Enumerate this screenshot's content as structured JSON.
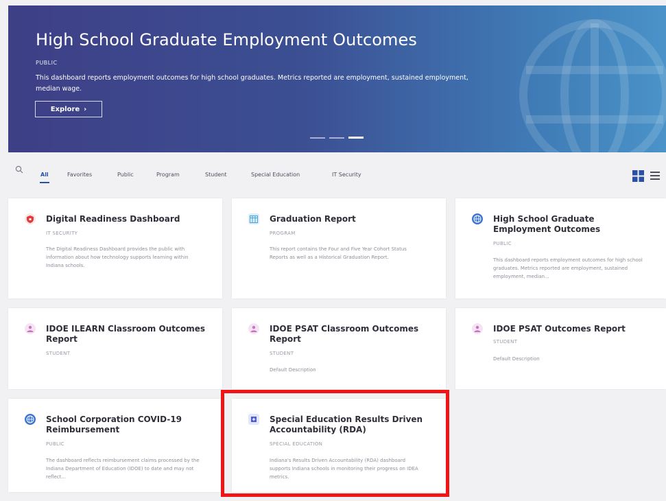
{
  "hero": {
    "title": "High School Graduate Employment Outcomes",
    "badge": "PUBLIC",
    "description": "This dashboard reports employment outcomes for high school graduates. Metrics reported are employment, sustained employment, median wage.",
    "explore_label": "Explore",
    "explore_chevron": "›"
  },
  "filters": {
    "tabs": [
      {
        "label": "All",
        "active": true
      },
      {
        "label": "Favorites"
      },
      {
        "label": "Public"
      },
      {
        "label": "Program"
      },
      {
        "label": "Student"
      },
      {
        "label": "Special Education"
      },
      {
        "label": "IT Security"
      }
    ]
  },
  "icons": {
    "search": "search-icon",
    "grid_view": "grid-view-icon",
    "list_view": "list-view-icon",
    "shield": "shield-icon",
    "table": "table-icon",
    "globe": "globe-icon",
    "user": "user-icon"
  },
  "colors": {
    "accent": "#2b4ea6",
    "highlight": "#f01414",
    "shield": "#e33b3b",
    "table": "#4aa3d8",
    "globe": "#3a74d0",
    "user": "#c774c0",
    "plus": "#4b5bd0"
  },
  "cards": [
    {
      "title": "Digital Readiness Dashboard",
      "category": "IT SECURITY",
      "description": "The Digital Readiness Dashboard provides the public with information about how technology supports learning within Indiana schools."
    },
    {
      "title": "Graduation Report",
      "category": "PROGRAM",
      "description": "This report contains the Four and Five Year Cohort Status Reports as well as a Historical Graduation Report."
    },
    {
      "title": "High School Graduate Employment Outcomes",
      "category": "PUBLIC",
      "description": "This dashboard reports employment outcomes for high school graduates. Metrics reported are employment, sustained employment, median..."
    },
    {
      "title": "IDOE ILEARN Classroom Outcomes Report",
      "category": "STUDENT",
      "description": ""
    },
    {
      "title": "IDOE PSAT Classroom Outcomes Report",
      "category": "STUDENT",
      "description": "Default Description"
    },
    {
      "title": "IDOE PSAT Outcomes Report",
      "category": "STUDENT",
      "description": "Default Description"
    },
    {
      "title": "School Corporation COVID-19 Reimbursement",
      "category": "PUBLIC",
      "description": "The dashboard reflects reimbursement claims processed by the Indiana Department of Education (IDOE) to date and may not reflect..."
    },
    {
      "title": "Special Education Results Driven Accountability (RDA)",
      "category": "SPECIAL EDUCATION",
      "description": "Indiana's Results Driven Accountability (RDA) dashboard supports Indiana schools in monitoring their progress on IDEA metrics."
    }
  ]
}
